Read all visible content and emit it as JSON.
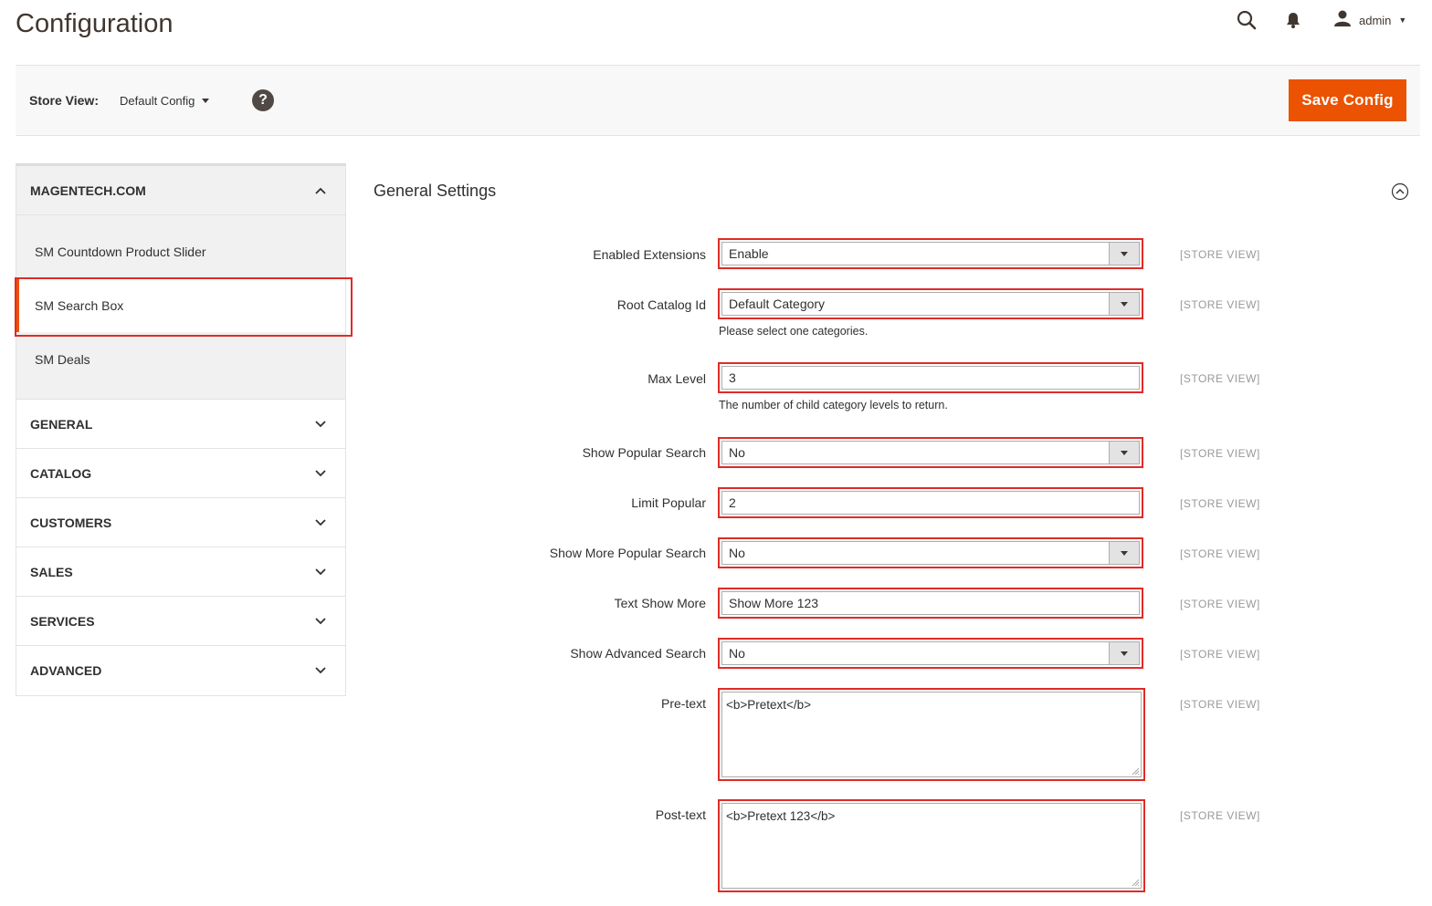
{
  "header": {
    "title": "Configuration",
    "user": "admin"
  },
  "toolbar": {
    "store_label": "Store View:",
    "store_value": "Default Config",
    "help": "?",
    "save_label": "Save Config"
  },
  "sidebar": {
    "open_section": "MAGENTECH.COM",
    "items": [
      "SM Countdown Product Slider",
      "SM Search Box",
      "SM Deals"
    ],
    "active_item": "SM Search Box",
    "sections": [
      "GENERAL",
      "CATALOG",
      "CUSTOMERS",
      "SALES",
      "SERVICES",
      "ADVANCED"
    ]
  },
  "main": {
    "section_title": "General Settings",
    "scope": "[STORE VIEW]",
    "fields": {
      "enabled_extensions": {
        "label": "Enabled Extensions",
        "value": "Enable"
      },
      "root_catalog_id": {
        "label": "Root Catalog Id",
        "value": "Default Category",
        "note": "Please select one categories."
      },
      "max_level": {
        "label": "Max Level",
        "value": "3",
        "note": "The number of child category levels to return."
      },
      "show_popular_search": {
        "label": "Show Popular Search",
        "value": "No"
      },
      "limit_popular": {
        "label": "Limit Popular",
        "value": "2"
      },
      "show_more_popular_search": {
        "label": "Show More Popular Search",
        "value": "No"
      },
      "text_show_more": {
        "label": "Text Show More",
        "value": "Show More 123"
      },
      "show_advanced_search": {
        "label": "Show Advanced Search",
        "value": "No"
      },
      "pre_text": {
        "label": "Pre-text",
        "value": "<b>Pretext</b>"
      },
      "post_text": {
        "label": "Post-text",
        "value": "<b>Pretext 123</b>"
      }
    }
  },
  "colors": {
    "accent": "#eb5202",
    "highlight": "#e02b27"
  }
}
